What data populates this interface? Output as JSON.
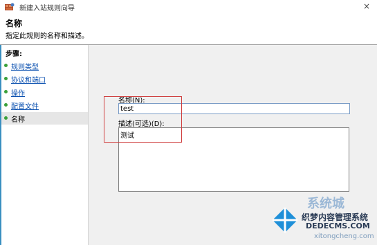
{
  "window": {
    "title": "新建入站规则向导",
    "app_icon": "firewall-wizard-icon",
    "close_symbol": "×"
  },
  "header": {
    "title": "名称",
    "subtitle": "指定此规则的名称和描述。"
  },
  "sidebar": {
    "heading": "步骤:",
    "items": [
      {
        "label": "规则类型",
        "active": false
      },
      {
        "label": "协议和端口",
        "active": false
      },
      {
        "label": "操作",
        "active": false
      },
      {
        "label": "配置文件",
        "active": false
      },
      {
        "label": "名称",
        "active": true
      }
    ]
  },
  "form": {
    "name_label": "名称(N):",
    "name_value": "test",
    "description_label": "描述(可选)(D):",
    "description_value": "测试"
  },
  "watermark": {
    "brand": "系统城",
    "line1": "织梦内容管理系统",
    "line2": "DEDECMS.COM",
    "line3": "xitongcheng.com"
  },
  "colors": {
    "accent_blue": "#3a8fc0",
    "step_dot_green": "#3aa03a",
    "link_blue": "#0a50b0",
    "highlight_red": "#d04040",
    "content_bg": "#f0f0f0"
  }
}
